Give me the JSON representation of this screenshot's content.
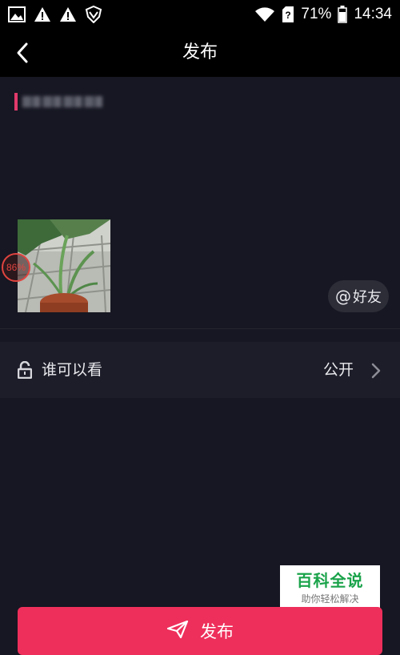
{
  "status_bar": {
    "battery_text": "71%",
    "time": "14:34",
    "icons": [
      "image-icon",
      "warning-icon",
      "warning-icon",
      "vpn-shield-icon",
      "wifi-icon",
      "sim-unknown-icon",
      "battery-icon"
    ]
  },
  "header": {
    "title": "发布",
    "back_icon": "chevron-left-icon"
  },
  "composer": {
    "caption_text": "",
    "upload_progress": "86%",
    "mention_button": {
      "at": "@",
      "label": "好友"
    }
  },
  "privacy": {
    "label": "谁可以看",
    "value": "公开",
    "icon": "unlock-icon"
  },
  "watermark": {
    "title": "百科全说",
    "subtitle": "助你轻松解决"
  },
  "publish_button": {
    "label": "发布",
    "icon": "send-icon"
  },
  "colors": {
    "accent": "#ee2f5b",
    "background": "#161722",
    "row_background": "#1c1d28"
  }
}
